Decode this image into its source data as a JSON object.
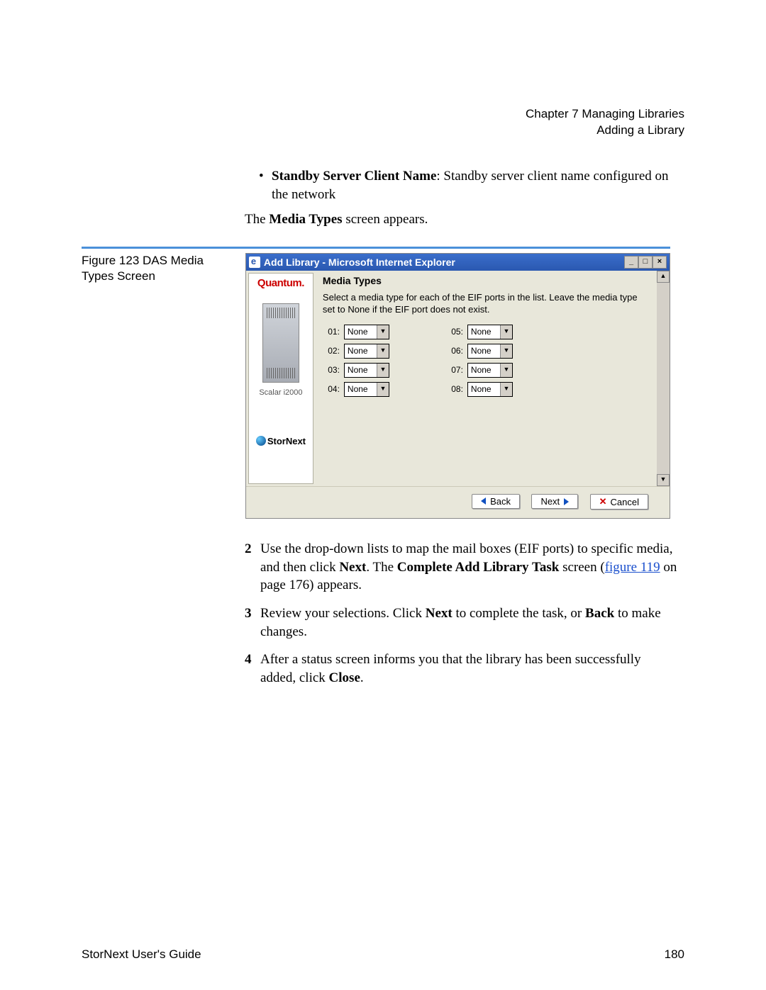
{
  "header": {
    "chapter": "Chapter 7  Managing Libraries",
    "section": "Adding a Library"
  },
  "bullet": {
    "lead": "Standby Server Client Name",
    "rest": ": Standby server client name configured on the network"
  },
  "intro_line_pre": "The ",
  "intro_line_bold": "Media Types",
  "intro_line_post": " screen appears.",
  "figure_caption": "Figure 123  DAS Media Types Screen",
  "screenshot": {
    "title": "Add Library - Microsoft Internet Explorer",
    "brand": "Quantum.",
    "device": "Scalar i2000",
    "product": "StorNext",
    "heading": "Media Types",
    "instructions": "Select a media type for each of the EIF ports in the list. Leave the media type set to None if the EIF port does not exist.",
    "ports_left": [
      {
        "label": "01:",
        "value": "None"
      },
      {
        "label": "02:",
        "value": "None"
      },
      {
        "label": "03:",
        "value": "None"
      },
      {
        "label": "04:",
        "value": "None"
      }
    ],
    "ports_right": [
      {
        "label": "05:",
        "value": "None"
      },
      {
        "label": "06:",
        "value": "None"
      },
      {
        "label": "07:",
        "value": "None"
      },
      {
        "label": "08:",
        "value": "None"
      }
    ],
    "buttons": {
      "back": "Back",
      "next": "Next",
      "cancel": "Cancel"
    }
  },
  "steps": {
    "s2_a": "Use the drop-down lists to map the mail boxes (EIF ports) to specific media, and then click ",
    "s2_b": "Next",
    "s2_c": ". The ",
    "s2_d": "Complete Add Library Task",
    "s2_e": " screen (",
    "s2_link": "figure 119",
    "s2_f": " on page 176) appears.",
    "s3_a": "Review your selections. Click ",
    "s3_b": "Next",
    "s3_c": " to complete the task, or ",
    "s3_d": "Back",
    "s3_e": " to make changes.",
    "s4_a": "After a status screen informs you that the library has been successfully added, click ",
    "s4_b": "Close",
    "s4_c": "."
  },
  "footer": {
    "left": "StorNext User's Guide",
    "right": "180"
  }
}
